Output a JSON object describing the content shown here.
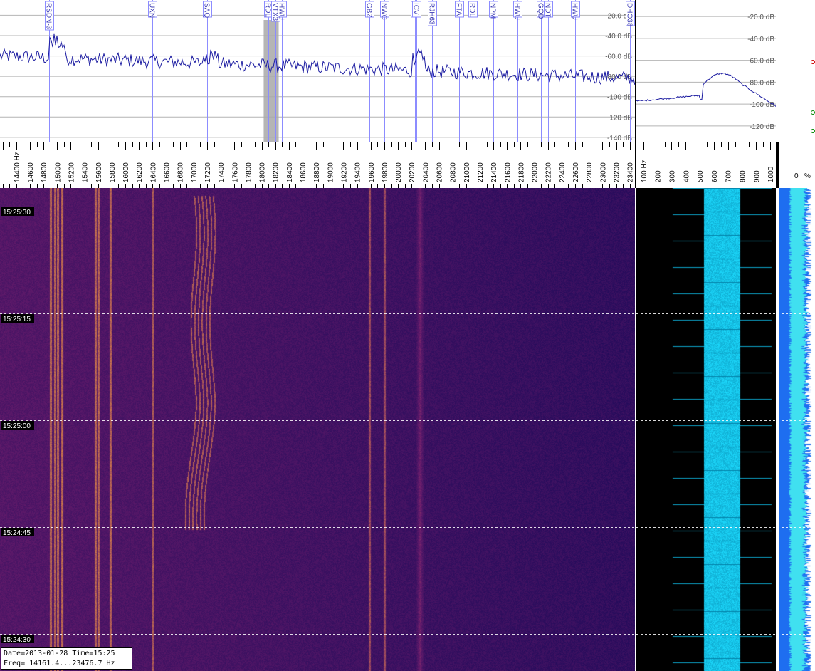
{
  "spectrum": {
    "db_labels": [
      "-20.0 dB",
      "-40.0 dB",
      "-60.0 dB",
      "-80.0 dB",
      "-100 dB",
      "-120 dB",
      "-140 dB"
    ],
    "db_values": [
      -20,
      -40,
      -60,
      -80,
      -100,
      -120,
      -140
    ],
    "freq_range_hz": [
      14161.4,
      23476.7
    ],
    "freq_axis_unit": "Hz",
    "freq_ticks": [
      14400,
      14600,
      14800,
      15000,
      15200,
      15400,
      15600,
      15800,
      16000,
      16200,
      16400,
      16600,
      16800,
      17000,
      17200,
      17400,
      17600,
      17800,
      18000,
      18200,
      18400,
      18600,
      18800,
      19000,
      19200,
      19400,
      19600,
      19800,
      20000,
      20200,
      20400,
      20600,
      20800,
      21000,
      21200,
      21400,
      21600,
      21800,
      22000,
      22200,
      22400,
      22600,
      22800,
      23000,
      23200,
      23400
    ],
    "markers": [
      {
        "label": "RSDN-3",
        "freq": 14880
      },
      {
        "label": "UXN",
        "freq": 16400
      },
      {
        "label": "SAQ",
        "freq": 17200
      },
      {
        "label": "RDL",
        "freq": 18100
      },
      {
        "label": "VTX3",
        "freq": 18200
      },
      {
        "label": "HWU",
        "freq": 18300
      },
      {
        "label": "GBZ",
        "freq": 19580
      },
      {
        "label": "NWC",
        "freq": 19800
      },
      {
        "label": "RDL",
        "freq": 20250
      },
      {
        "label": "ICV",
        "freq": 20270
      },
      {
        "label": "RJH63",
        "freq": 20500
      },
      {
        "label": "FTA",
        "freq": 20900
      },
      {
        "label": "RDL",
        "freq": 21100
      },
      {
        "label": "NPM",
        "freq": 21400
      },
      {
        "label": "HWU",
        "freq": 21750
      },
      {
        "label": "GQD",
        "freq": 22100
      },
      {
        "label": "NDT",
        "freq": 22200
      },
      {
        "label": "HWU",
        "freq": 22600
      },
      {
        "label": "DHO38",
        "freq": 23400
      }
    ]
  },
  "zoom": {
    "db_labels": [
      "-20.0 dB",
      "-40.0 dB",
      "-60.0 dB",
      "-80.0 dB",
      "-100 dB",
      "-120 dB"
    ],
    "db_values": [
      -20,
      -40,
      -60,
      -80,
      -100,
      -120
    ],
    "freq_ticks": [
      100,
      200,
      300,
      400,
      500,
      600,
      700,
      800,
      900,
      1000
    ],
    "freq_axis_unit": "Hz"
  },
  "level_meter": {
    "label_value": "0",
    "label_unit": "%"
  },
  "waterfall": {
    "time_labels": [
      "15:25:30",
      "15:25:15",
      "15:25:00",
      "15:24:45",
      "15:24:30"
    ]
  },
  "status": {
    "line1": "Date=2013-01-28 Time=15:25",
    "line2": "Freq= 14161.4...23476.7 Hz"
  },
  "colors": {
    "spectrum_trace": "#1a1aa0",
    "marker_line": "#8c8cff",
    "grid": "#b4b4b4",
    "waterfall_low": "#2a1470",
    "waterfall_high": "#f0a040",
    "zoom_signal": "#3a8cff"
  }
}
